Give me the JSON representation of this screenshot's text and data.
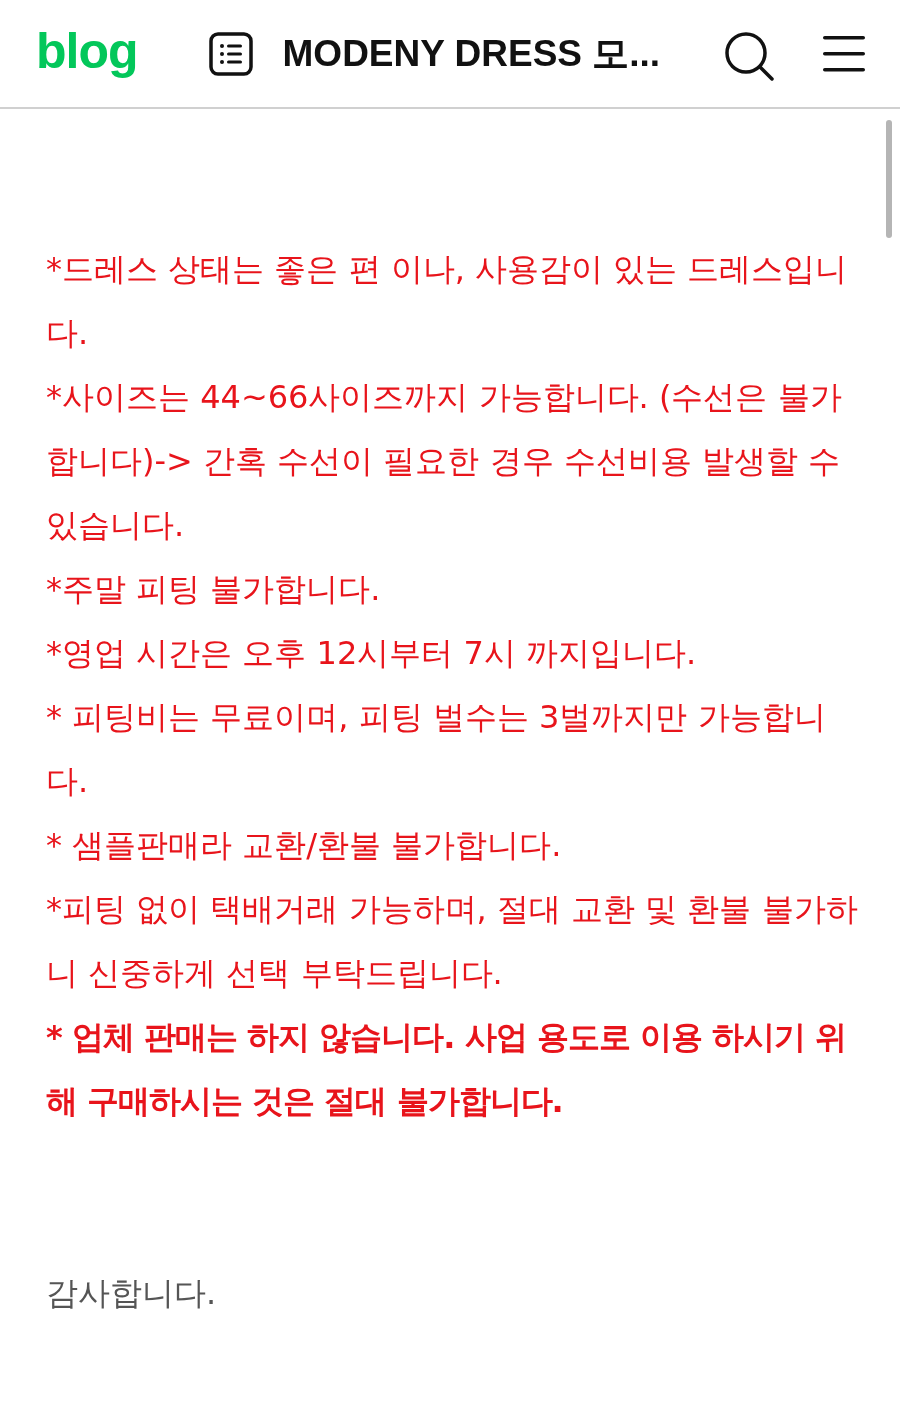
{
  "header": {
    "logo": "blog",
    "title": "MODENY DRESS 모..."
  },
  "paragraphs": [
    {
      "text": "*드레스 상태는 좋은 편 이나, 사용감이 있는 드레스입니다.",
      "color": "#e8141b",
      "bold": false
    },
    {
      "text": "*사이즈는 44~66사이즈까지 가능합니다. (수선은 불가합니다)-> 간혹 수선이 필요한 경우 수선비용 발생할 수 있습니다.",
      "color": "#e8141b",
      "bold": false
    },
    {
      "text": "*주말 피팅 불가합니다.",
      "color": "#e8141b",
      "bold": false
    },
    {
      "text": "*영업 시간은 오후 12시부터 7시 까지입니다.",
      "color": "#e8141b",
      "bold": false
    },
    {
      "text": "* 피팅비는 무료이며, 피팅 벌수는 3벌까지만 가능합니다.",
      "color": "#e8141b",
      "bold": false
    },
    {
      "text": "* 샘플판매라 교환/환불 불가합니다.",
      "color": "#e8141b",
      "bold": false
    },
    {
      "text": "*피팅 없이 택배거래 가능하며, 절대 교환 및 환불 불가하니 신중하게 선택 부탁드립니다.",
      "color": "#e8141b",
      "bold": false
    },
    {
      "text": "* 업체 판매는 하지 않습니다. 사업 용도로 이용 하시기 위해 구매하시는 것은 절대 불가합니다.",
      "color": "#e8141b",
      "bold": true
    }
  ],
  "closing": {
    "text": "감사합니다.",
    "color": "#555555"
  }
}
